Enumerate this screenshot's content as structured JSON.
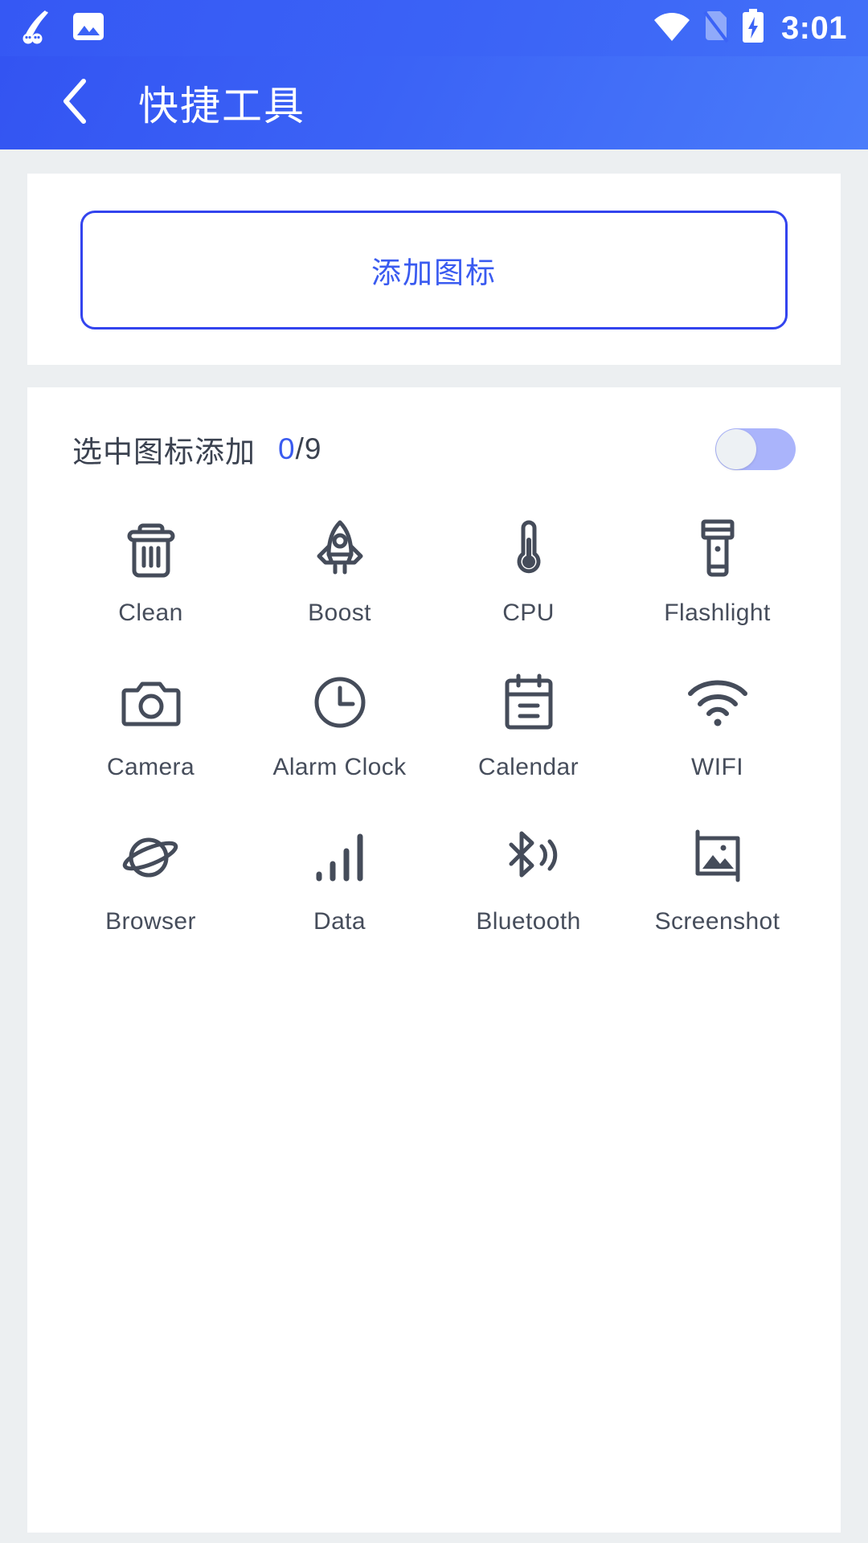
{
  "statusbar": {
    "time": "3:01",
    "icons": {
      "notification": "feather-notification-icon",
      "gallery": "image-icon",
      "wifi": "wifi-icon",
      "sim": "no-sim-icon",
      "battery": "battery-charging-icon"
    }
  },
  "header": {
    "title": "快捷工具",
    "back_icon": "chevron-left-icon"
  },
  "add_card": {
    "button_label": "添加图标"
  },
  "select_card": {
    "label": "选中图标添加",
    "count_current": "0",
    "count_separator": "/9",
    "toggle_state": "off"
  },
  "tools": [
    {
      "label": "Clean",
      "icon": "trash-icon"
    },
    {
      "label": "Boost",
      "icon": "rocket-icon"
    },
    {
      "label": "CPU",
      "icon": "thermometer-icon"
    },
    {
      "label": "Flashlight",
      "icon": "flashlight-icon"
    },
    {
      "label": "Camera",
      "icon": "camera-icon"
    },
    {
      "label": "Alarm Clock",
      "icon": "clock-icon"
    },
    {
      "label": "Calendar",
      "icon": "calendar-icon"
    },
    {
      "label": "WIFI",
      "icon": "wifi-icon"
    },
    {
      "label": "Browser",
      "icon": "planet-icon"
    },
    {
      "label": "Data",
      "icon": "signal-bars-icon"
    },
    {
      "label": "Bluetooth",
      "icon": "bluetooth-icon"
    },
    {
      "label": "Screenshot",
      "icon": "screenshot-icon"
    }
  ],
  "colors": {
    "header_blue": "#3b63f6",
    "accent_blue": "#3a5bf0",
    "border_blue": "#3344ee",
    "toggle_track": "#aab4fb",
    "icon_gray": "#454c5a",
    "page_bg": "#eceff1"
  }
}
